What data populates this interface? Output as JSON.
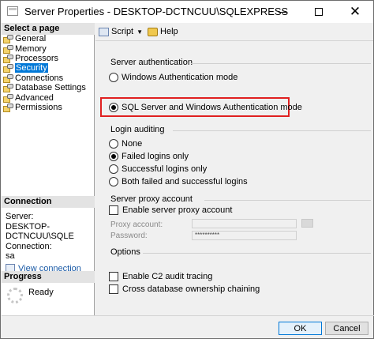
{
  "window": {
    "title": "Server Properties - DESKTOP-DCTNCUU\\SQLEXPRESS"
  },
  "left": {
    "select_page_header": "Select a page",
    "pages": [
      {
        "label": "General"
      },
      {
        "label": "Memory"
      },
      {
        "label": "Processors"
      },
      {
        "label": "Security",
        "selected": true
      },
      {
        "label": "Connections"
      },
      {
        "label": "Database Settings"
      },
      {
        "label": "Advanced"
      },
      {
        "label": "Permissions"
      }
    ],
    "connection_header": "Connection",
    "server_label": "Server:",
    "server_value": "DESKTOP-DCTNCUU\\SQLE",
    "connection_label": "Connection:",
    "connection_value": "sa",
    "view_connection": "View connection",
    "progress_header": "Progress",
    "progress_status": "Ready"
  },
  "toolbar": {
    "script": "Script",
    "help": "Help"
  },
  "security": {
    "server_auth": {
      "title": "Server authentication",
      "windows_mode": "Windows Authentication mode",
      "mixed_mode": "SQL Server and Windows Authentication mode",
      "selected": "mixed_mode"
    },
    "login_auditing": {
      "title": "Login auditing",
      "options": [
        "None",
        "Failed logins only",
        "Successful logins only",
        "Both failed and successful logins"
      ],
      "selected": "Failed logins only"
    },
    "proxy": {
      "title": "Server proxy account",
      "enable_label": "Enable server proxy account",
      "enabled": false,
      "proxy_account_label": "Proxy account:",
      "proxy_account_value": "",
      "password_label": "Password:",
      "password_value": "**********"
    },
    "options": {
      "title": "Options",
      "c2_audit": "Enable C2 audit tracing",
      "c2_checked": false,
      "cross_db": "Cross database ownership chaining",
      "cross_db_checked": false
    }
  },
  "buttons": {
    "ok": "OK",
    "cancel": "Cancel"
  }
}
